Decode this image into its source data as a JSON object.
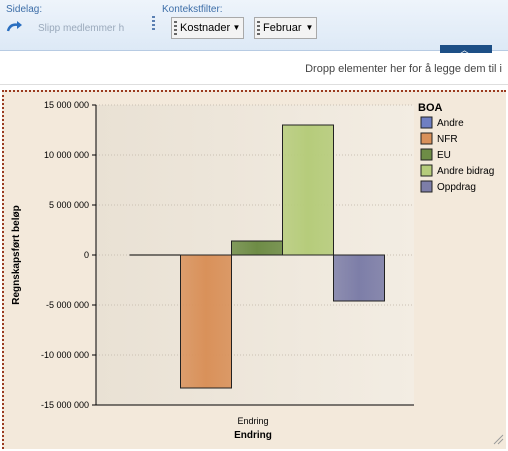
{
  "toolbar": {
    "sidelag_label": "Sidelag:",
    "slipp_placeholder": "Slipp medlemmer h",
    "kontekst_label": "Kontekstfilter:",
    "filter1": "Kostnader",
    "filter2": "Februar",
    "drop_hint": "Dropp elementer her for å legge dem til i"
  },
  "colors": {
    "Andre": "#6f7fc2",
    "NFR": "#d9915a",
    "EU": "#6e8c46",
    "Andre bidrag": "#b6cc7b",
    "Oppdrag": "#7d7ea8"
  },
  "chart_data": {
    "type": "bar",
    "title": "",
    "categories": [
      "Endring"
    ],
    "xlabel": "Endring",
    "ylabel": "Regnskapsført beløp",
    "ylim": [
      -15000000,
      15000000
    ],
    "yticks": [
      15000000,
      10000000,
      5000000,
      0,
      -5000000,
      -10000000,
      -15000000
    ],
    "ytick_labels": [
      "15 000 000",
      "10 000 000",
      "5 000 000",
      "0",
      "-5 000 000",
      "-10 000 000",
      "-15 000 000"
    ],
    "legend_title": "BOA",
    "legend_position": "right",
    "grid": true,
    "series": [
      {
        "name": "Andre",
        "values": [
          0
        ]
      },
      {
        "name": "NFR",
        "values": [
          -13300000
        ]
      },
      {
        "name": "EU",
        "values": [
          1400000
        ]
      },
      {
        "name": "Andre bidrag",
        "values": [
          13000000
        ]
      },
      {
        "name": "Oppdrag",
        "values": [
          -4600000
        ]
      }
    ]
  }
}
